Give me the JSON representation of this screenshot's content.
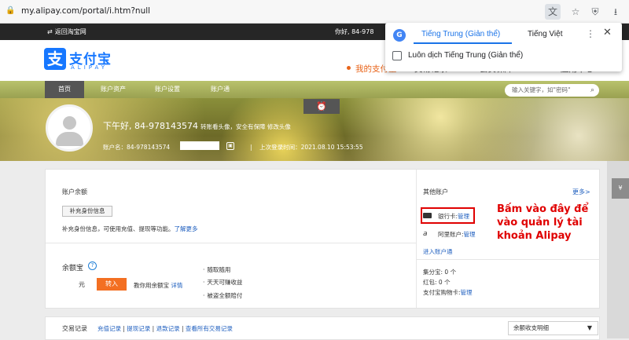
{
  "browser": {
    "url": "my.alipay.com/portal/i.htm?null"
  },
  "topbar": {
    "back_label": "返回淘宝网",
    "greeting": "你好, 84-978"
  },
  "header": {
    "logo_cn": "支付宝",
    "logo_en": "ALIPAY",
    "nav": [
      "我的支付宝",
      "交易记录",
      "会员保障",
      "应用中心"
    ]
  },
  "menubar": {
    "tabs": [
      "首页",
      "账户资产",
      "账户设置",
      "账户通"
    ],
    "search_placeholder": "输入关键字，如\"密码\""
  },
  "profile": {
    "greeting": "下午好, 84-978143574",
    "greeting_note": "转账看头像，安全有保障 修改头像",
    "account_name_label": "账户名：84-978143574",
    "last_login": "上次登录时间：2021.08.10 15:53:55",
    "separator": "|"
  },
  "balance": {
    "title": "账户余额",
    "verify_button": "补充身份信息",
    "info_text": "补充身份信息，可使用充值、提现等功能。",
    "info_link": "了解更多"
  },
  "yuebao": {
    "title": "余额宝",
    "help": "?",
    "unit": "元",
    "transfer_button": "转入",
    "teach_text": "教你用余额宝",
    "teach_link": "详情",
    "features": [
      "随取随用",
      "天天可赚收益",
      "被盗全额赔付"
    ]
  },
  "other_accounts": {
    "title": "其他账户",
    "more": "更多>",
    "bank_label": "银行卡:",
    "bank_link": "管理",
    "alipay_label": "阿里账户:",
    "alipay_link": "管理",
    "enter_link": "进入账户通",
    "jifen": "集分宝: 0 个",
    "hongbao": "红包: 0 个",
    "shopping_label": "支付宝购物卡:",
    "shopping_link": "管理"
  },
  "annotation": {
    "text": "Bấm vào đây để vào quản lý tài khoản Alipay"
  },
  "transactions": {
    "title": "交易记录",
    "links": [
      "充值记录",
      "提现记录",
      "退款记录",
      "查看所有交易记录"
    ],
    "select_value": "余额收支明细"
  },
  "translate_popup": {
    "tab_source": "Tiếng Trung (Giản thể)",
    "tab_target": "Tiếng Việt",
    "always_label": "Luôn dịch Tiếng Trung (Giản thể)"
  },
  "side": {
    "label": "¥"
  },
  "colors": {
    "accent": "#1677ff",
    "orange": "#f36f22",
    "annotation_red": "#e00000",
    "link": "#1f5fbf"
  }
}
